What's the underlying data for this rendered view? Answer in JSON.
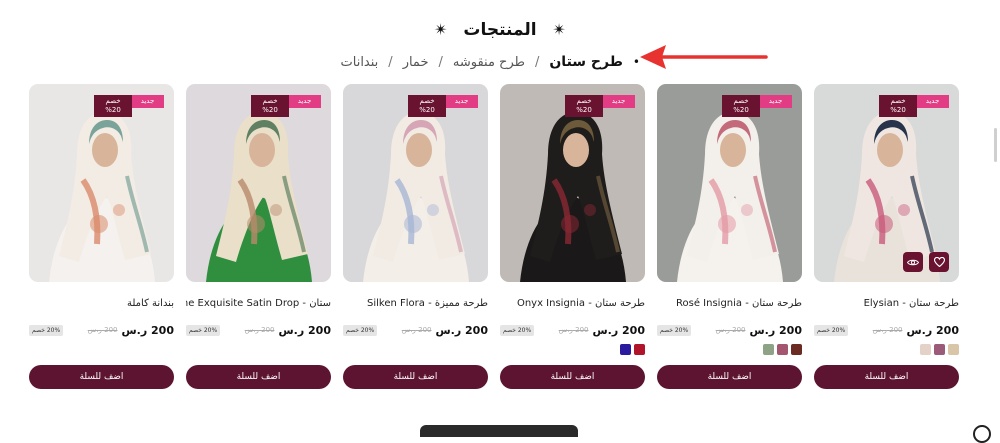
{
  "section": {
    "title": "المنتجات",
    "star": "✴"
  },
  "categories": [
    {
      "label": "طرح ستان",
      "active": true
    },
    {
      "label": "طرح منقوشه",
      "active": false
    },
    {
      "label": "خمار",
      "active": false
    },
    {
      "label": "بندانات",
      "active": false
    }
  ],
  "category_separator": "/",
  "products": [
    {
      "name": "طرحة ستان - Elysian",
      "badge_new": "جديد",
      "badge_discount": "خصم 20%",
      "price": "200",
      "currency": "ر.س",
      "old_price": "200",
      "discount_tag": "20% خصم",
      "swatches": [
        "#d9c6a8",
        "#9a5a78",
        "#e4d2c8"
      ],
      "cart_label": "اضف للسلة",
      "has_actions": true
    },
    {
      "name": "طرحة ستان - Rosé Insignia",
      "badge_new": "جديد",
      "badge_discount": "خصم 20%",
      "price": "200",
      "currency": "ر.س",
      "old_price": "200",
      "discount_tag": "20% خصم",
      "swatches": [
        "#6b2a22",
        "#a4566e",
        "#8ea285"
      ],
      "cart_label": "اضف للسلة",
      "has_actions": false
    },
    {
      "name": "طرحة ستان - Onyx Insignia",
      "badge_new": "جديد",
      "badge_discount": "خصم 20%",
      "price": "200",
      "currency": "ر.س",
      "old_price": "200",
      "discount_tag": "20% خصم",
      "swatches": [
        "#b0132a",
        "#2a1a9e"
      ],
      "cart_label": "اضف للسلة",
      "has_actions": false
    },
    {
      "name": "طرحة مميزة - Silken Flora",
      "badge_new": "جديد",
      "badge_discount": "خصم 20%",
      "price": "200",
      "currency": "ر.س",
      "old_price": "200",
      "discount_tag": "20% خصم",
      "swatches": [],
      "cart_label": "اضف للسلة",
      "has_actions": false
    },
    {
      "name": "ستان - The Exquisite Satin Drop",
      "badge_new": "جديد",
      "badge_discount": "خصم 20%",
      "price": "200",
      "currency": "ر.س",
      "old_price": "200",
      "discount_tag": "20% خصم",
      "swatches": [],
      "cart_label": "اضف للسلة",
      "has_actions": false
    },
    {
      "name": "بندانة كاملة",
      "badge_new": "جديد",
      "badge_discount": "خصم 20%",
      "price": "200",
      "currency": "ر.س",
      "old_price": "200",
      "discount_tag": "20% خصم",
      "swatches": [],
      "cart_label": "اضف للسلة",
      "has_actions": false
    }
  ],
  "colors": {
    "brand": "#5c1430",
    "badge_new": "#e23c84",
    "badge_discount": "#6a1330",
    "arrow": "#e8322f"
  }
}
